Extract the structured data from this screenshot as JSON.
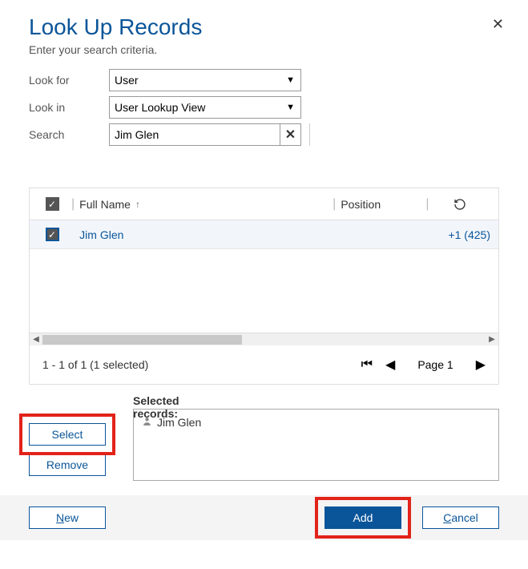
{
  "dialog": {
    "title": "Look Up Records",
    "subtitle": "Enter your search criteria."
  },
  "criteria": {
    "lookfor_label": "Look for",
    "lookfor_value": "User",
    "lookin_label": "Look in",
    "lookin_value": "User Lookup View",
    "search_label": "Search",
    "search_value": "Jim Glen"
  },
  "grid": {
    "columns": {
      "fullname": "Full Name",
      "position": "Position"
    },
    "rows": [
      {
        "name": "Jim Glen",
        "position": "",
        "phone": "+1 (425)"
      }
    ]
  },
  "pager": {
    "count_text": "1 - 1 of 1 (1 selected)",
    "page_text": "Page 1"
  },
  "selected": {
    "label": "Selected records:",
    "items": [
      {
        "name": "Jim Glen"
      }
    ]
  },
  "buttons": {
    "select": "Select",
    "remove": "Remove",
    "new": "New",
    "add": "Add",
    "cancel": "Cancel"
  }
}
